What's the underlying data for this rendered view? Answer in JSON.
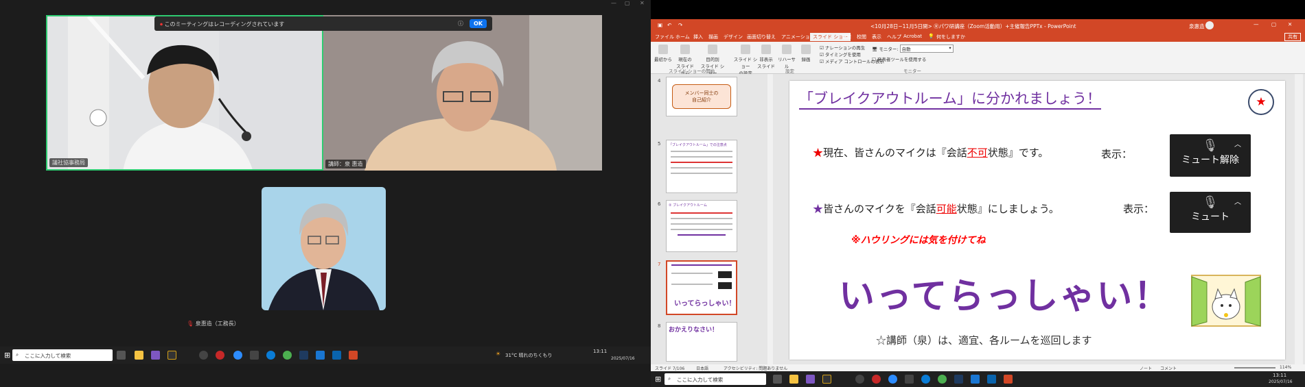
{
  "zoom": {
    "recording_banner": "このミーティングはレコーディングされています",
    "ok_label": "OK",
    "participants": [
      {
        "name": "議社協事務局"
      },
      {
        "name": "講師：泉 惠造"
      },
      {
        "name": "泉惠造（工務長）"
      }
    ],
    "colors": {
      "active_speaker_border": "#2ecc71",
      "ok_button": "#0e72ed"
    }
  },
  "taskbar_left": {
    "search_placeholder": "ここに入力して検索",
    "weather": "31°C 晴れのちくもり",
    "time": "13:11",
    "date": "2025/07/16"
  },
  "ppt": {
    "window_title": "<10月28日~11月5日開>  Ⓡパワ研講座（Zoom活動用）+主催報告PPTx - PowerPoint",
    "user": "泉惠造",
    "share_label": "共有",
    "tabs": [
      "ファイル",
      "ホーム",
      "挿入",
      "描画",
      "デザイン",
      "画面切り替え",
      "アニメーション",
      "スライド ショー",
      "記録",
      "校閲",
      "表示",
      "ヘルプ",
      "Acrobat",
      "何をしますか"
    ],
    "active_tab": "スライド ショー",
    "ribbon": {
      "from_start": "最初から",
      "from_current": "現在の\nスライドから",
      "custom": "目的別\nスライド ショー",
      "setup": "スライド ショー\nの設定",
      "hide": "非表示\nスライド",
      "rehearse": "リハーサル",
      "record": "録画",
      "chk_narration": "ナレーションの再生",
      "chk_timing": "タイミングを使用",
      "chk_media": "メディア コントロールの表示",
      "monitor_label": "モニター:",
      "monitor_value": "自動",
      "presenter_view": "発表者ツールを使用する",
      "group_start": "スライド ショーの開始",
      "group_setup": "設定",
      "group_monitor": "モニター"
    },
    "thumbnails": [
      {
        "num": "4",
        "text": "メンバー同士の\n自己紹介"
      },
      {
        "num": "5",
        "text": "「ブレイクアウトルーム」での注意点"
      },
      {
        "num": "6",
        "text": "② ブレイクアウトルーム"
      },
      {
        "num": "7",
        "text": "いってらっしゃい！"
      },
      {
        "num": "8",
        "text": "おかえりなさい！"
      }
    ],
    "slide": {
      "title": "「ブレイクアウトルーム」に分かれましょう！",
      "star": "★",
      "line1_prefix": "★",
      "line1_a": "現在、皆さんのマイクは『会話",
      "line1_red": "不可",
      "line1_b": "状態』です。",
      "line2_prefix": "★",
      "line2_a": "皆さんのマイクを『会話",
      "line2_red": "可能",
      "line2_b": "状態』にしましょう。",
      "display_label": "表示：",
      "mute_off_label": "ミュート解除",
      "mute_label": "ミュート",
      "howling": "※ハウリングには気を付けてね",
      "big": "いってらっしゃい！",
      "note": "☆講師（泉）は、適宜、各ルームを巡回します"
    },
    "status": {
      "slide_count": "スライド 7/106",
      "language": "日本語",
      "accessibility": "アクセシビリティ: 問題ありません",
      "notes": "ノート",
      "comments": "コメント",
      "zoom": "114%"
    },
    "taskbar": {
      "search_placeholder": "ここに入力して検索",
      "time": "13:11",
      "date": "2025/07/16"
    },
    "colors": {
      "accent": "#d24726",
      "title_purple": "#7030a0",
      "red": "#ff0000"
    }
  }
}
